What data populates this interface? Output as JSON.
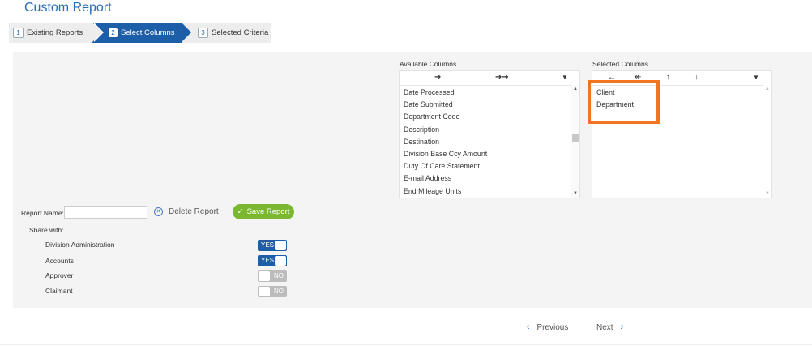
{
  "page": {
    "title": "Custom Report"
  },
  "steps": [
    {
      "num": "1",
      "label": "Existing Reports"
    },
    {
      "num": "2",
      "label": "Select Columns"
    },
    {
      "num": "3",
      "label": "Selected Criteria"
    }
  ],
  "available": {
    "label": "Available Columns",
    "toolbar": {
      "add": "➔",
      "add_all": "➔➔",
      "filter": "▼"
    },
    "items": [
      "Date Processed",
      "Date Submitted",
      "Department Code",
      "Description",
      "Destination",
      "Division Base Ccy Amount",
      "Duty Of Care Statement",
      "E-mail Address",
      "End Mileage Units"
    ]
  },
  "selected": {
    "label": "Selected Columns",
    "toolbar": {
      "remove": "←",
      "remove_all": "↞",
      "up": "↑",
      "down": "↓",
      "filter": "▼"
    },
    "items": [
      "Client",
      "Department"
    ]
  },
  "form": {
    "report_name_label": "Report Name:",
    "report_name_value": "",
    "delete_label": "Delete Report",
    "save_label": "Save Report",
    "share_label": "Share with:",
    "share": [
      {
        "name": "Division Administration",
        "state": "YES"
      },
      {
        "name": "Accounts",
        "state": "YES"
      },
      {
        "name": "Approver",
        "state": "NO"
      },
      {
        "name": "Claimant",
        "state": "NO"
      }
    ]
  },
  "pager": {
    "previous": "Previous",
    "next": "Next"
  },
  "colors": {
    "brand": "#1d5ea8",
    "save": "#7cb82f",
    "highlight": "#f47521"
  }
}
